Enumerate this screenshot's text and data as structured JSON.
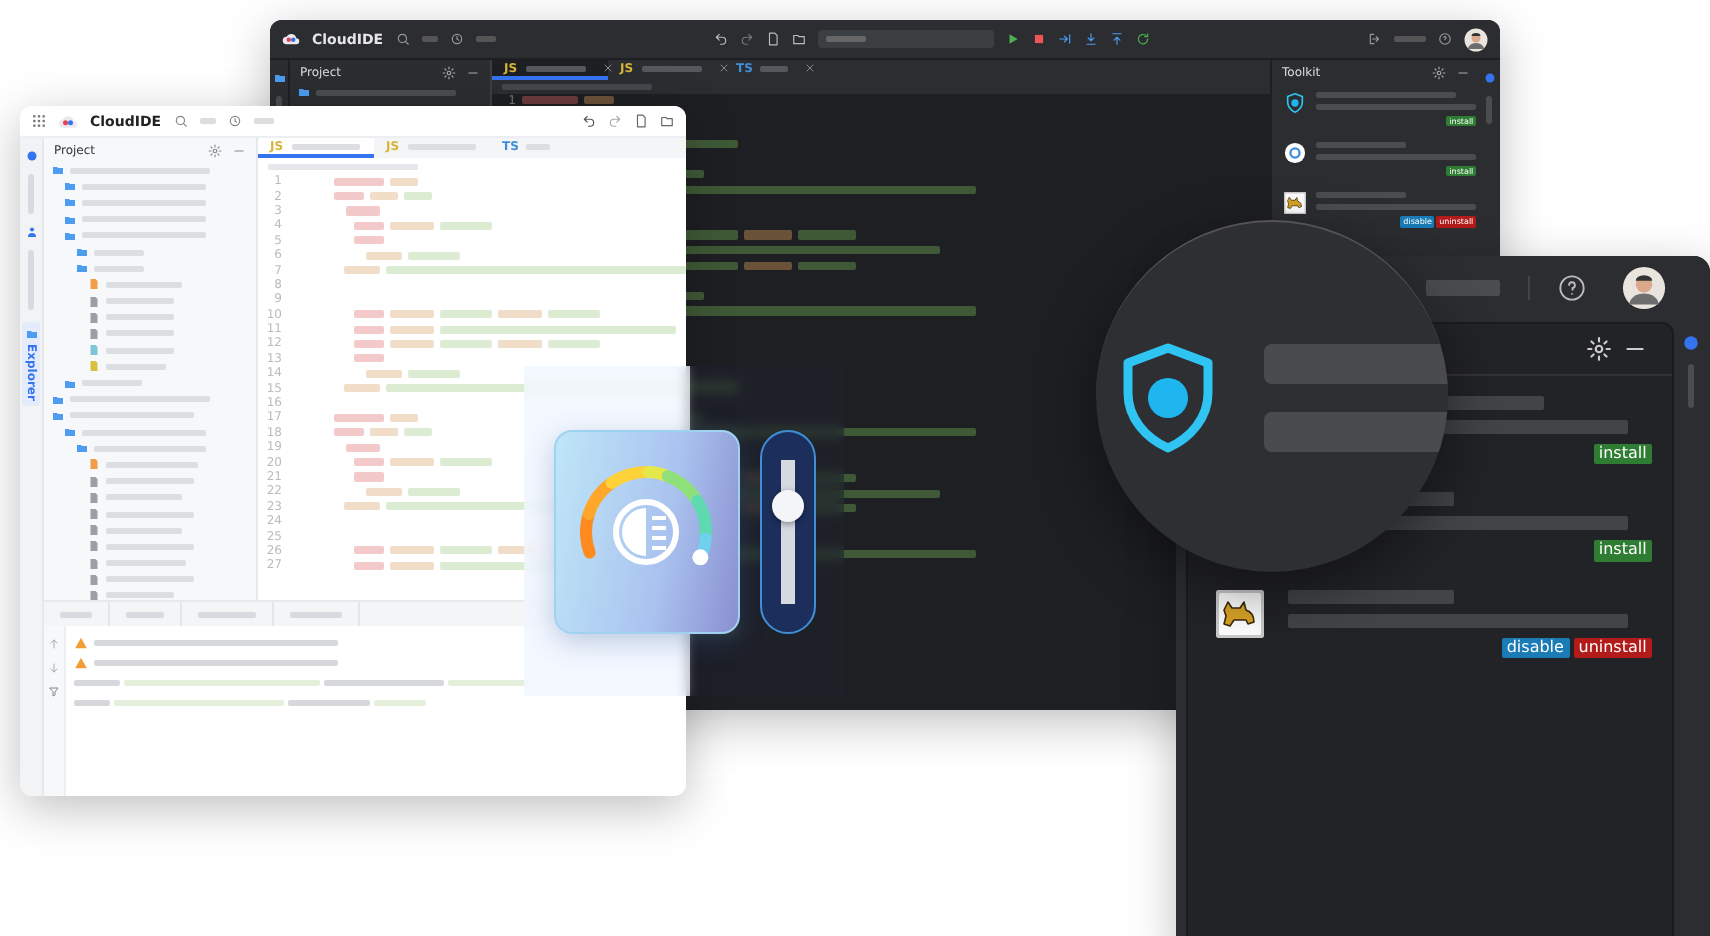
{
  "dark_ide": {
    "title": "CloudIDE",
    "project_panel": {
      "title": "Project"
    },
    "tabs": [
      {
        "label": "JS",
        "selected": true
      },
      {
        "label": "JS",
        "selected": false
      },
      {
        "label": "TS",
        "selected": false
      }
    ],
    "line_numbers": [
      "1"
    ],
    "toolkit": {
      "title": "Toolkit",
      "plugins": [
        {
          "kind": "shield",
          "actions": [
            {
              "label": "install",
              "kind": "install"
            }
          ]
        },
        {
          "kind": "ring",
          "actions": [
            {
              "label": "install",
              "kind": "install"
            }
          ]
        },
        {
          "kind": "cat",
          "actions": [
            {
              "label": "disable",
              "kind": "disable"
            },
            {
              "label": "uninstall",
              "kind": "uninstall"
            }
          ]
        }
      ]
    }
  },
  "light_ide": {
    "title": "CloudIDE",
    "project_panel": {
      "title": "Project"
    },
    "explorer_label": "Explorer",
    "tabs": [
      {
        "label": "JS",
        "selected": true
      },
      {
        "label": "JS",
        "selected": false
      },
      {
        "label": "TS",
        "selected": false
      }
    ],
    "line_numbers": [
      "1",
      "2",
      "3",
      "4",
      "5",
      "6",
      "7",
      "8",
      "9",
      "10",
      "11",
      "12",
      "13",
      "14",
      "15",
      "16",
      "17",
      "18",
      "19",
      "20",
      "21",
      "22",
      "23",
      "24",
      "25",
      "26",
      "27"
    ]
  },
  "glass_widget": {
    "slider": {
      "level": 0.72
    }
  },
  "plugin_panel": {
    "plugins": [
      {
        "actions": [
          {
            "label": "install",
            "kind": "install"
          }
        ]
      },
      {
        "actions": [
          {
            "label": "install",
            "kind": "install"
          }
        ]
      },
      {
        "kind": "cat",
        "actions": [
          {
            "label": "disable",
            "kind": "disable"
          },
          {
            "label": "uninstall",
            "kind": "uninstall"
          }
        ]
      }
    ]
  }
}
